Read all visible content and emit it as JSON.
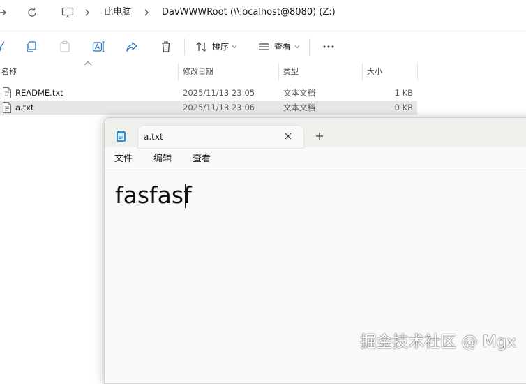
{
  "explorer": {
    "address": {
      "segment1": "此电脑",
      "segment2": "DavWWWRoot (\\\\localhost@8080) (Z:)"
    },
    "toolbar": {
      "sort_label": "排序",
      "view_label": "查看"
    },
    "columns": {
      "name": "名称",
      "modified": "修改日期",
      "type": "类型",
      "size": "大小"
    },
    "files": [
      {
        "name": "README.txt",
        "modified": "2025/11/13 23:05",
        "type": "文本文档",
        "size": "1 KB"
      },
      {
        "name": "a.txt",
        "modified": "2025/11/13 23:06",
        "type": "文本文档",
        "size": "0 KB"
      }
    ]
  },
  "notepad": {
    "tab_title": "a.txt",
    "menu": {
      "file": "文件",
      "edit": "编辑",
      "view": "查看"
    },
    "content": "fasfasf"
  },
  "watermark": "掘金技术社区 @ Mgx"
}
